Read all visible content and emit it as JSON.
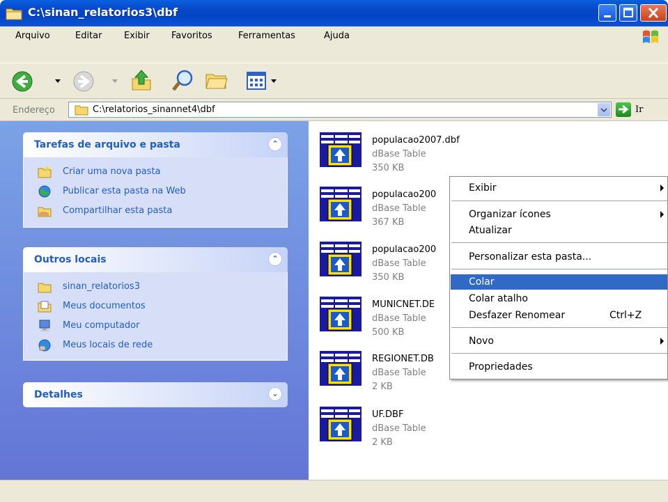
{
  "window": {
    "title": "C:\\sinan_relatorios3\\dbf"
  },
  "menubar": {
    "items": [
      "Arquivo",
      "Editar",
      "Exibir",
      "Favoritos",
      "Ferramentas",
      "Ajuda"
    ]
  },
  "address": {
    "label": "Endereço",
    "value": "C:\\relatorios_sinannet4\\dbf",
    "go_label": "Ir"
  },
  "taskpane": {
    "tasks": {
      "title": "Tarefas de arquivo e pasta",
      "links": [
        "Criar uma nova pasta",
        "Publicar esta pasta na Web",
        "Compartilhar esta pasta"
      ]
    },
    "other": {
      "title": "Outros locais",
      "links": [
        "sinan_relatorios3",
        "Meus documentos",
        "Meu computador",
        "Meus locais de rede"
      ]
    },
    "details": {
      "title": "Detalhes"
    }
  },
  "files": [
    {
      "name": "populacao2007.dbf",
      "type": "dBase Table",
      "size": "350 KB"
    },
    {
      "name": "populacao200",
      "type": "dBase Table",
      "size": "367 KB"
    },
    {
      "name": "populacao200",
      "type": "dBase Table",
      "size": "350 KB"
    },
    {
      "name": "MUNICNET.DE",
      "type": "dBase Table",
      "size": "500 KB"
    },
    {
      "name": "REGIONET.DB",
      "type": "dBase Table",
      "size": "2 KB"
    },
    {
      "name": "UF.DBF",
      "type": "dBase Table",
      "size": "2 KB"
    }
  ],
  "context_menu": {
    "exibir": "Exibir",
    "organizar": "Organizar ícones",
    "atualizar": "Atualizar",
    "personalizar": "Personalizar esta pasta...",
    "colar": "Colar",
    "colar_atalho": "Colar atalho",
    "desfazer": "Desfazer Renomear",
    "desfazer_shortcut": "Ctrl+Z",
    "novo": "Novo",
    "propriedades": "Propriedades"
  },
  "colors": {
    "selection": "#316ac5",
    "link": "#215dc6",
    "titlebar": "#0546c6"
  }
}
